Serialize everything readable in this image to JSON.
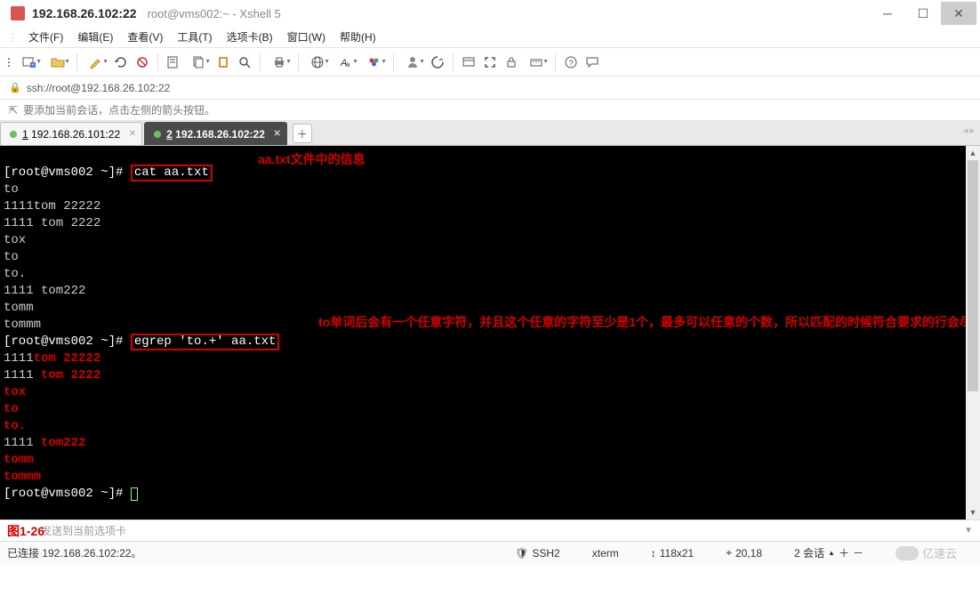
{
  "window": {
    "ip": "192.168.26.102:22",
    "path": "root@vms002:~ - Xshell 5"
  },
  "menu": {
    "file": "文件(F)",
    "edit": "编辑(E)",
    "view": "查看(V)",
    "tools": "工具(T)",
    "tabs": "选项卡(B)",
    "window": "窗口(W)",
    "help": "帮助(H)"
  },
  "address": {
    "url": "ssh://root@192.168.26.102:22"
  },
  "tip": {
    "text": "要添加当前会话，点击左侧的箭头按钮。"
  },
  "tabs": {
    "t1_prefix": "1",
    "t1_label": " 192.168.26.101:22",
    "t2_prefix": "2",
    "t2_label": " 192.168.26.102:22"
  },
  "term": {
    "prompt": "[root@vms002 ~]#",
    "cmd1": "cat aa.txt",
    "note1": "aa.txt文件中的信息",
    "l_to": "to",
    "l_1tom2": "1111tom 22222",
    "l_1_tom_2": "1111 tom 2222",
    "l_tox": "tox",
    "l_to2": "to",
    "l_todot": "to.",
    "l_tom222": "1111 tom222",
    "l_tomm": "tomm",
    "l_tommm": "tommm",
    "cmd2": "egrep 'to.+' aa.txt",
    "note2": "to单词后会有一个任意字符，并且这个任意的字符至少是1个，最多可以任意的个数，所以匹配的时候符合要求的行会尽可能的向后进行匹配",
    "r1_a": "1111",
    "r1_b": "tom 22222",
    "r2_a": "1111 ",
    "r2_b": "tom 2222",
    "r3": "tox",
    "r4_a": "to",
    "r4_b": " ",
    "r5": "to.",
    "r6_a": "1111 ",
    "r6_b": "tom222",
    "r7": "tomm",
    "r8": "tommm"
  },
  "figure": {
    "label": "图1-26",
    "hint": "发送到当前选项卡"
  },
  "status": {
    "conn": "已连接 192.168.26.102:22。",
    "proto": "SSH2",
    "term": "xterm",
    "size": "118x21",
    "pos": "20,18",
    "sessions": "2 会话",
    "watermark": "亿速云"
  }
}
